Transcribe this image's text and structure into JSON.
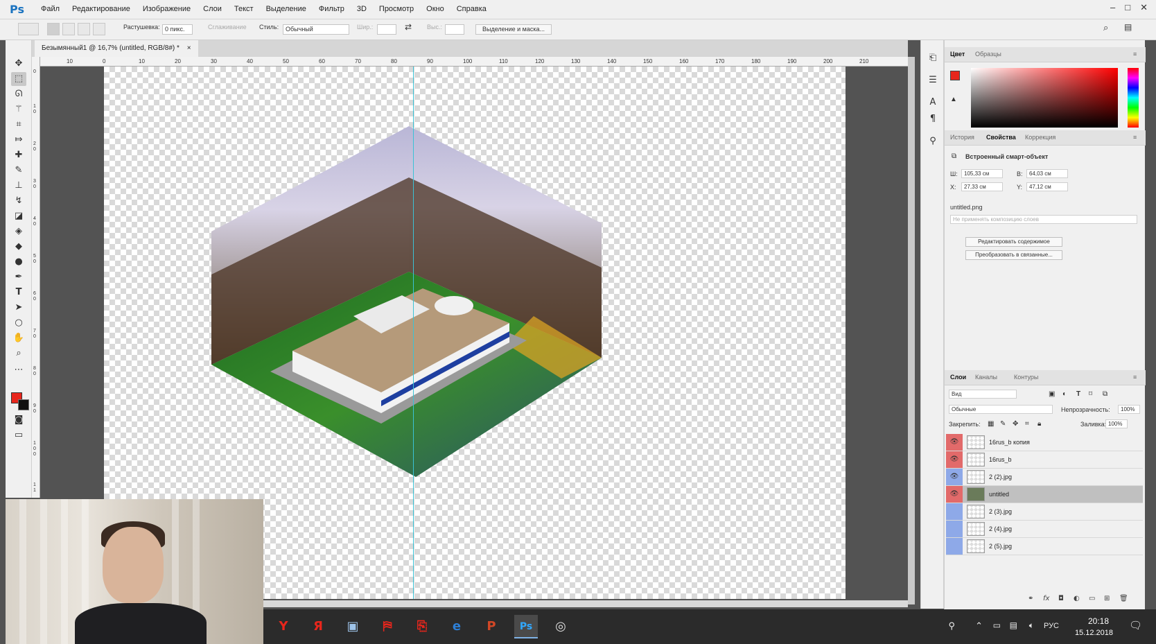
{
  "app": {
    "logo": "Ps"
  },
  "menu": [
    "Файл",
    "Редактирование",
    "Изображение",
    "Слои",
    "Текст",
    "Выделение",
    "Фильтр",
    "3D",
    "Просмотр",
    "Окно",
    "Справка"
  ],
  "options": {
    "feather_label": "Растушевка:",
    "feather_value": "0 пикс.",
    "antialias_label": "Сглаживание",
    "style_label": "Стиль:",
    "style_value": "Обычный",
    "width_label": "Шир.:",
    "height_label": "Выс.:",
    "mask_button": "Выделение и маска..."
  },
  "document": {
    "tab_title": "Безымянный1 @ 16,7% (untitled, RGB/8#) *",
    "ruler_h": [
      "10",
      "0",
      "10",
      "20",
      "30",
      "40",
      "50",
      "60",
      "70",
      "80",
      "90",
      "100",
      "110",
      "120",
      "130",
      "140",
      "150",
      "160",
      "170",
      "180",
      "190",
      "200",
      "210"
    ],
    "ruler_v": [
      "0",
      "1 0",
      "2 0",
      "3 0",
      "4 0",
      "5 0",
      "6 0",
      "7 0",
      "8 0",
      "9 0",
      "1 0 0",
      "1 1"
    ]
  },
  "color_panel": {
    "tabs": [
      "Цвет",
      "Образцы"
    ],
    "foreground": "#e8261c",
    "background": "#111111"
  },
  "properties_panel": {
    "tabs": [
      "История",
      "Свойства",
      "Коррекция"
    ],
    "title": "Встроенный смарт-объект",
    "w_label": "Ш:",
    "w_value": "105,33 см",
    "h_label": "В:",
    "h_value": "64,03 см",
    "x_label": "X:",
    "x_value": "27,33 см",
    "y_label": "Y:",
    "y_value": "47,12 см",
    "filename": "untitled.png",
    "comp_select": "Не применять композицию слоев",
    "edit_button": "Редактировать содержимое",
    "convert_button": "Преобразовать в связанные..."
  },
  "layers_panel": {
    "tabs": [
      "Слои",
      "Каналы",
      "Контуры"
    ],
    "filter_value": "Вид",
    "blend_value": "Обычные",
    "opacity_label": "Непрозрачность:",
    "opacity_value": "100%",
    "lock_label": "Закрепить:",
    "fill_label": "Заливка:",
    "fill_value": "100%",
    "layers": [
      {
        "name": "16rus_b копия",
        "visible": true,
        "selected": false
      },
      {
        "name": "16rus_b",
        "visible": true,
        "selected": false
      },
      {
        "name": "2 (2).jpg",
        "visible": true,
        "selected": false
      },
      {
        "name": "untitled",
        "visible": true,
        "selected": true
      },
      {
        "name": "2 (3).jpg",
        "visible": false,
        "selected": false
      },
      {
        "name": "2 (4).jpg",
        "visible": false,
        "selected": false
      },
      {
        "name": "2 (5).jpg",
        "visible": false,
        "selected": false
      }
    ]
  },
  "taskbar": {
    "apps": [
      "Y",
      "Я",
      "▣",
      "⛿",
      "⎘",
      "e",
      "P",
      "Ps",
      "◎"
    ],
    "lang": "РУС",
    "time": "20:18",
    "date": "15.12.2018"
  }
}
